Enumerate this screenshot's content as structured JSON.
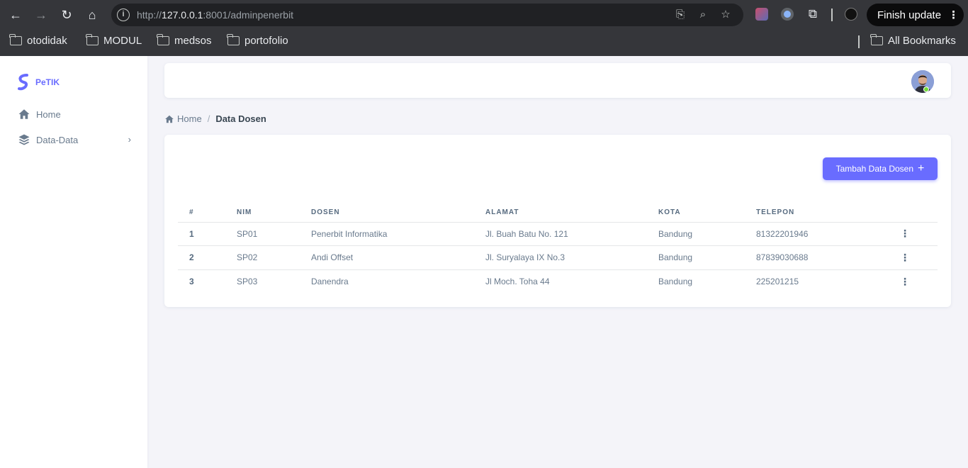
{
  "browser": {
    "url_prefix": "http://",
    "url_host": "127.0.0.1",
    "url_rest": ":8001/adminpenerbit",
    "finish_update": "Finish update",
    "bookmarks": [
      "otodidak",
      "MODUL",
      "medsos",
      "portofolio"
    ],
    "all_bookmarks": "All Bookmarks"
  },
  "sidebar": {
    "brand": "PeTIK",
    "items": [
      {
        "label": "Home",
        "icon": "home-icon"
      },
      {
        "label": "Data-Data",
        "icon": "layers-icon"
      }
    ]
  },
  "breadcrumb": {
    "home": "Home",
    "current": "Data Dosen"
  },
  "card": {
    "add_button": "Tambah Data Dosen",
    "columns": [
      "#",
      "NIM",
      "DOSEN",
      "ALAMAT",
      "KOTA",
      "TELEPON"
    ],
    "rows": [
      {
        "no": "1",
        "nim": "SP01",
        "dosen": "Penerbit Informatika",
        "alamat": "Jl. Buah Batu No. 121",
        "kota": "Bandung",
        "telepon": "81322201946"
      },
      {
        "no": "2",
        "nim": "SP02",
        "dosen": "Andi Offset",
        "alamat": "Jl. Suryalaya IX No.3",
        "kota": "Bandung",
        "telepon": "87839030688"
      },
      {
        "no": "3",
        "nim": "SP03",
        "dosen": "Danendra",
        "alamat": "Jl Moch. Toha 44",
        "kota": "Bandung",
        "telepon": "225201215"
      }
    ]
  },
  "colors": {
    "primary": "#696cff",
    "online": "#71dd37"
  }
}
